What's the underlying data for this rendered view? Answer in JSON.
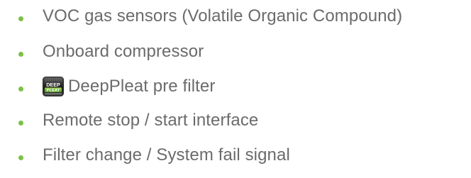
{
  "bullet_color": "#7cc142",
  "text_color": "#6b6b6b",
  "items": [
    {
      "label": "VOC gas sensors (Volatile Organic Compound)"
    },
    {
      "label": "Onboard compressor"
    },
    {
      "label": "DeepPleat pre filter",
      "logo": {
        "icon": "deeppleat-logo",
        "line1": "DEEP",
        "line2": "PLEAT"
      }
    },
    {
      "label": "Remote stop / start interface"
    },
    {
      "label": "Filter change / System fail signal"
    }
  ]
}
